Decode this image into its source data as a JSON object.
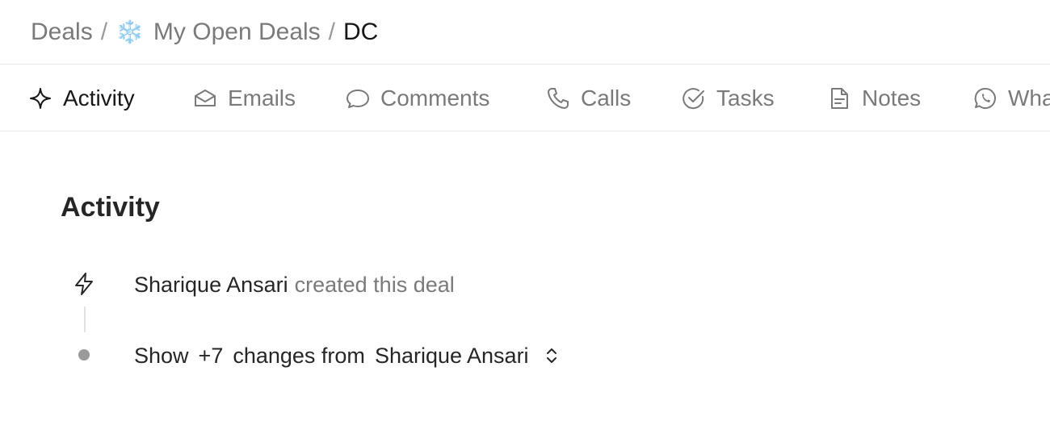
{
  "breadcrumb": {
    "root": "Deals",
    "separator": "/",
    "view_icon": "❄️",
    "view": "My Open Deals",
    "current": "DC"
  },
  "tabs": [
    {
      "label": "Activity",
      "icon": "sparkle-icon",
      "active": true
    },
    {
      "label": "Emails",
      "icon": "envelope-icon",
      "active": false
    },
    {
      "label": "Comments",
      "icon": "comment-icon",
      "active": false
    },
    {
      "label": "Calls",
      "icon": "phone-icon",
      "active": false
    },
    {
      "label": "Tasks",
      "icon": "check-circle-icon",
      "active": false
    },
    {
      "label": "Notes",
      "icon": "note-icon",
      "active": false
    },
    {
      "label": "Wha",
      "icon": "whatsapp-icon",
      "active": false
    }
  ],
  "section": {
    "title": "Activity"
  },
  "activity": {
    "created": {
      "user": "Sharique Ansari",
      "action": "created this deal",
      "icon": "bolt-icon"
    },
    "changes": {
      "show": "Show",
      "count": "+7",
      "text": "changes from",
      "user": "Sharique Ansari",
      "toggle_icon": "chevron-up-down-icon"
    }
  },
  "colors": {
    "text_primary": "#171717",
    "text_muted": "#7a7a7a",
    "border": "#e6e6e6"
  }
}
